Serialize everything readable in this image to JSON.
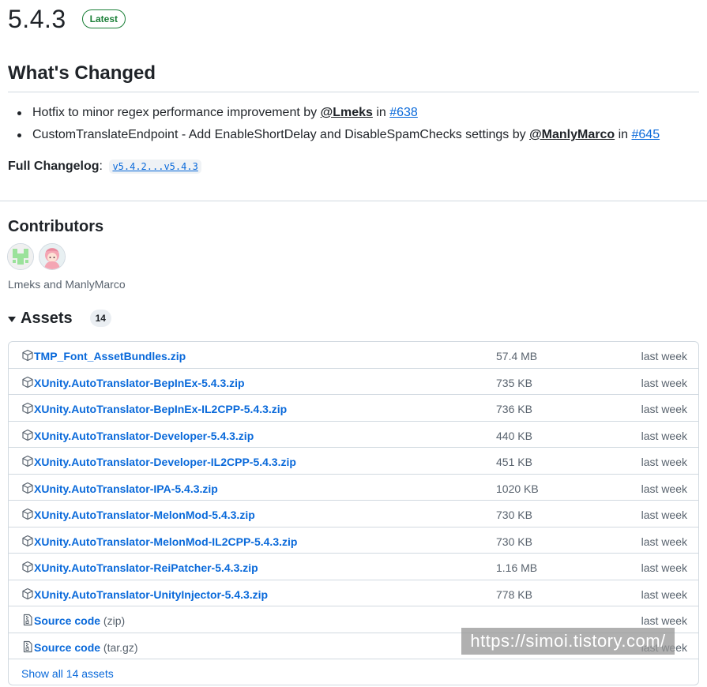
{
  "release": {
    "title": "5.4.3",
    "badge": "Latest"
  },
  "whats_changed": {
    "title": "What's Changed",
    "items": [
      {
        "text": "Hotfix to minor regex performance improvement by ",
        "author": "@Lmeks",
        "mid": " in ",
        "pr": "#638"
      },
      {
        "text": "CustomTranslateEndpoint - Add EnableShortDelay and DisableSpamChecks settings by ",
        "author": "@ManlyMarco",
        "mid": " in ",
        "pr": "#645"
      }
    ],
    "changelog_label": "Full Changelog",
    "changelog_sep": ": ",
    "changelog_link": "v5.4.2...v5.4.3"
  },
  "contributors": {
    "title": "Contributors",
    "names": "Lmeks and ManlyMarco",
    "avatars": [
      "lmeks-avatar",
      "manlymarco-avatar"
    ]
  },
  "assets": {
    "title": "Assets",
    "count": "14",
    "rows": [
      {
        "name": "TMP_Font_AssetBundles.zip",
        "size": "57.4 MB",
        "date": "last week",
        "icon": "package-icon"
      },
      {
        "name": "XUnity.AutoTranslator-BepInEx-5.4.3.zip",
        "size": "735 KB",
        "date": "last week",
        "icon": "package-icon"
      },
      {
        "name": "XUnity.AutoTranslator-BepInEx-IL2CPP-5.4.3.zip",
        "size": "736 KB",
        "date": "last week",
        "icon": "package-icon"
      },
      {
        "name": "XUnity.AutoTranslator-Developer-5.4.3.zip",
        "size": "440 KB",
        "date": "last week",
        "icon": "package-icon"
      },
      {
        "name": "XUnity.AutoTranslator-Developer-IL2CPP-5.4.3.zip",
        "size": "451 KB",
        "date": "last week",
        "icon": "package-icon"
      },
      {
        "name": "XUnity.AutoTranslator-IPA-5.4.3.zip",
        "size": "1020 KB",
        "date": "last week",
        "icon": "package-icon"
      },
      {
        "name": "XUnity.AutoTranslator-MelonMod-5.4.3.zip",
        "size": "730 KB",
        "date": "last week",
        "icon": "package-icon"
      },
      {
        "name": "XUnity.AutoTranslator-MelonMod-IL2CPP-5.4.3.zip",
        "size": "730 KB",
        "date": "last week",
        "icon": "package-icon"
      },
      {
        "name": "XUnity.AutoTranslator-ReiPatcher-5.4.3.zip",
        "size": "1.16 MB",
        "date": "last week",
        "icon": "package-icon"
      },
      {
        "name": "XUnity.AutoTranslator-UnityInjector-5.4.3.zip",
        "size": "778 KB",
        "date": "last week",
        "icon": "package-icon"
      },
      {
        "name": "Source code",
        "suffix": "(zip)",
        "size": "",
        "date": "last week",
        "icon": "file-zip-icon"
      },
      {
        "name": "Source code",
        "suffix": "(tar.gz)",
        "size": "",
        "date": "last week",
        "icon": "file-zip-icon"
      }
    ],
    "show_all": "Show all 14 assets"
  },
  "watermark": "https://simoi.tistory.com/",
  "colors": {
    "link": "#0969da",
    "latest_green": "#1a7f37",
    "muted": "#59636e",
    "border": "#d1d9e0"
  }
}
